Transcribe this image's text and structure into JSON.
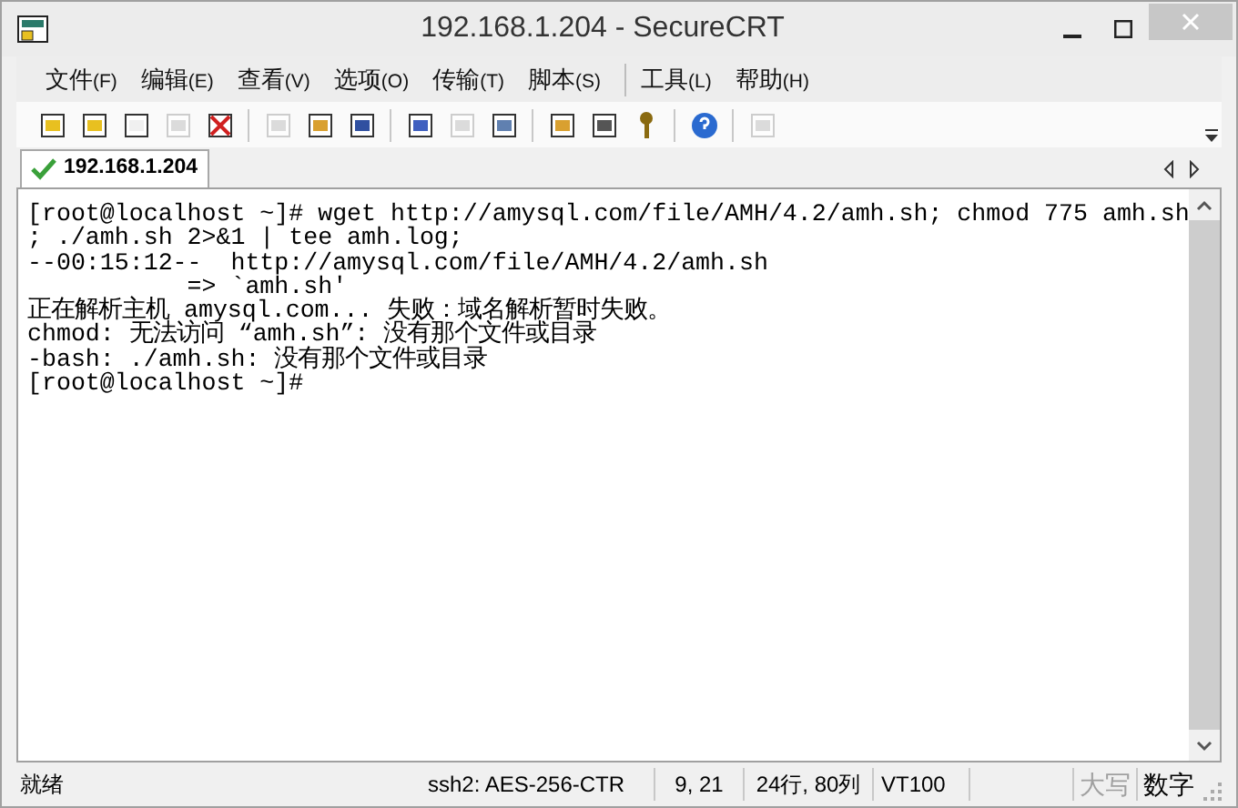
{
  "window": {
    "title": "192.168.1.204 - SecureCRT"
  },
  "menu_groups": [
    [
      {
        "label": "文件",
        "key": "(F)"
      },
      {
        "label": "编辑",
        "key": "(E)"
      },
      {
        "label": "查看",
        "key": "(V)"
      },
      {
        "label": "选项",
        "key": "(O)"
      },
      {
        "label": "传输",
        "key": "(T)"
      },
      {
        "label": "脚本",
        "key": "(S)"
      }
    ],
    [
      {
        "label": "工具",
        "key": "(L)"
      },
      {
        "label": "帮助",
        "key": "(H)"
      }
    ]
  ],
  "toolbar_groups": [
    [
      {
        "disabled": false
      },
      {
        "disabled": false
      },
      {
        "disabled": false
      },
      {
        "disabled": true
      },
      {
        "disabled": false
      }
    ],
    [
      {
        "disabled": true
      },
      {
        "disabled": false
      },
      {
        "disabled": false
      }
    ],
    [
      {
        "disabled": false
      },
      {
        "disabled": true
      },
      {
        "disabled": false
      }
    ],
    [
      {
        "disabled": false
      },
      {
        "disabled": false
      },
      {
        "disabled": false
      }
    ],
    [
      {
        "disabled": false
      }
    ],
    [
      {
        "disabled": true
      }
    ]
  ],
  "tabs": [
    {
      "label": "192.168.1.204",
      "selected": true,
      "connected": true
    }
  ],
  "terminal": {
    "lines": [
      "[root@localhost ~]# wget http://amysql.com/file/AMH/4.2/amh.sh; chmod 775 amh.sh",
      "; ./amh.sh 2>&1 | tee amh.log;",
      "--00:15:12--  http://amysql.com/file/AMH/4.2/amh.sh",
      "           => `amh.sh'",
      "正在解析主机 amysql.com... 失败：域名解析暂时失败。",
      "chmod: 无法访问 “amh.sh”: 没有那个文件或目录",
      "-bash: ./amh.sh: 没有那个文件或目录",
      "[root@localhost ~]#"
    ]
  },
  "status_bar": {
    "status": "就绪",
    "cipher": "ssh2: AES-256-CTR",
    "cursor": "9, 21",
    "size": "24行, 80列",
    "emulation": "VT100",
    "indicators": [
      {
        "label": "大写",
        "on": false
      },
      {
        "label": "数字",
        "on": true
      }
    ]
  }
}
